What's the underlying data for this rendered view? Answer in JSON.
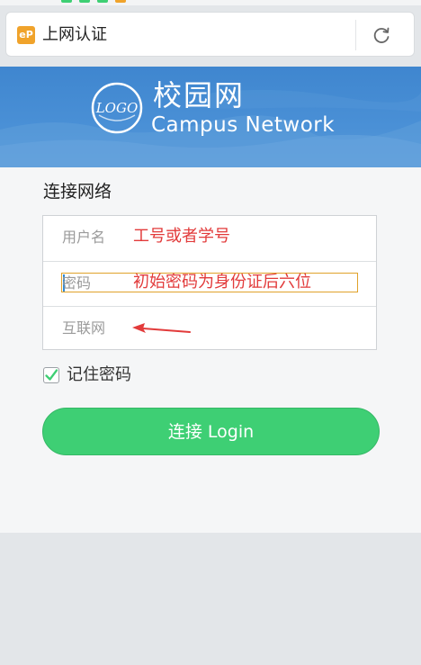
{
  "address_bar": {
    "site_icon_text": "eP",
    "page_title": "上网认证",
    "refresh_icon": "refresh-icon"
  },
  "banner": {
    "logo_text": "LOGO",
    "title": "校园网",
    "subtitle": "Campus Network"
  },
  "form": {
    "title": "连接网络",
    "username": {
      "placeholder": "用户名",
      "annotation": "工号或者学号"
    },
    "password": {
      "placeholder": "密码",
      "annotation": "初始密码为身份证后六位"
    },
    "network": {
      "placeholder": "互联网"
    },
    "remember": {
      "label": "记住密码",
      "checked": true
    },
    "login_button": "连接 Login"
  },
  "colors": {
    "banner_blue": "#4a90d6",
    "button_green": "#3ecf74",
    "annotation_red": "#e23b3b",
    "highlight_orange": "#e0a22a"
  }
}
